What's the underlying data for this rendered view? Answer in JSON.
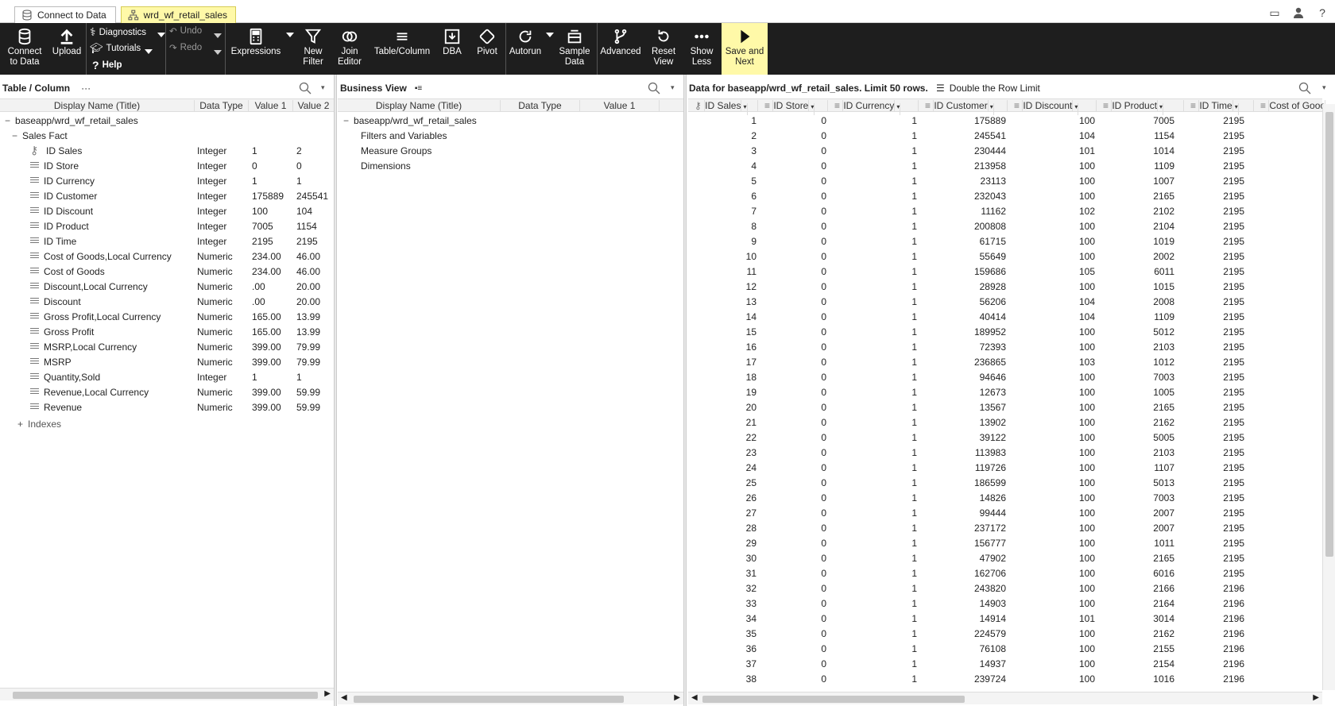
{
  "tabs": [
    {
      "label": "Connect to Data",
      "icon": "database-icon",
      "active": false
    },
    {
      "label": "wrd_wf_retail_sales",
      "icon": "schema-icon",
      "active": true
    }
  ],
  "toolbar": {
    "connect": "Connect\nto Data",
    "upload": "Upload",
    "diagnostics": "Diagnostics",
    "tutorials": "Tutorials",
    "help": "Help",
    "undo": "Undo",
    "redo": "Redo",
    "expressions": "Expressions",
    "new_filter": "New\nFilter",
    "join_editor": "Join\nEditor",
    "table_column": "Table/Column",
    "dba": "DBA",
    "pivot": "Pivot",
    "autorun": "Autorun",
    "sample_data": "Sample\nData",
    "advanced": "Advanced",
    "reset_view": "Reset\nView",
    "show_less": "Show\nLess",
    "save_next": "Save and\nNext"
  },
  "left_panel": {
    "title": "Table / Column",
    "more": "···",
    "columns": [
      "Display Name (Title)",
      "Data Type",
      "Value 1",
      "Value 2"
    ],
    "root": "baseapp/wrd_wf_retail_sales",
    "group": "Sales Fact",
    "rows": [
      {
        "name": "ID Sales",
        "type": "Integer",
        "v1": "1",
        "v2": "2",
        "key": true
      },
      {
        "name": "ID Store",
        "type": "Integer",
        "v1": "0",
        "v2": "0"
      },
      {
        "name": "ID Currency",
        "type": "Integer",
        "v1": "1",
        "v2": "1"
      },
      {
        "name": "ID Customer",
        "type": "Integer",
        "v1": "175889",
        "v2": "245541"
      },
      {
        "name": "ID Discount",
        "type": "Integer",
        "v1": "100",
        "v2": "104"
      },
      {
        "name": "ID Product",
        "type": "Integer",
        "v1": "7005",
        "v2": "1154"
      },
      {
        "name": "ID Time",
        "type": "Integer",
        "v1": "2195",
        "v2": "2195"
      },
      {
        "name": "Cost of Goods,Local Currency",
        "type": "Numeric",
        "v1": "234.00",
        "v2": "46.00"
      },
      {
        "name": "Cost of Goods",
        "type": "Numeric",
        "v1": "234.00",
        "v2": "46.00"
      },
      {
        "name": "Discount,Local Currency",
        "type": "Numeric",
        "v1": ".00",
        "v2": "20.00"
      },
      {
        "name": "Discount",
        "type": "Numeric",
        "v1": ".00",
        "v2": "20.00"
      },
      {
        "name": "Gross Profit,Local Currency",
        "type": "Numeric",
        "v1": "165.00",
        "v2": "13.99"
      },
      {
        "name": "Gross Profit",
        "type": "Numeric",
        "v1": "165.00",
        "v2": "13.99"
      },
      {
        "name": "MSRP,Local Currency",
        "type": "Numeric",
        "v1": "399.00",
        "v2": "79.99"
      },
      {
        "name": "MSRP",
        "type": "Numeric",
        "v1": "399.00",
        "v2": "79.99"
      },
      {
        "name": "Quantity,Sold",
        "type": "Integer",
        "v1": "1",
        "v2": "1"
      },
      {
        "name": "Revenue,Local Currency",
        "type": "Numeric",
        "v1": "399.00",
        "v2": "59.99"
      },
      {
        "name": "Revenue",
        "type": "Numeric",
        "v1": "399.00",
        "v2": "59.99"
      }
    ],
    "indexes": "Indexes"
  },
  "middle_panel": {
    "title": "Business View",
    "columns": [
      "Display Name (Title)",
      "Data Type",
      "Value 1"
    ],
    "root": "baseapp/wrd_wf_retail_sales",
    "items": [
      "Filters and Variables",
      "Measure Groups",
      "Dimensions"
    ]
  },
  "right_panel": {
    "title": "Data for baseapp/wrd_wf_retail_sales. Limit 50 rows.",
    "double_limit": "Double the Row Limit",
    "columns": [
      "ID Sales",
      "ID Store",
      "ID Currency",
      "ID Customer",
      "ID Discount",
      "ID Product",
      "ID Time",
      "Cost of Gooc"
    ],
    "rows": [
      [
        "1",
        "0",
        "1",
        "175889",
        "100",
        "7005",
        "2195"
      ],
      [
        "2",
        "0",
        "1",
        "245541",
        "104",
        "1154",
        "2195"
      ],
      [
        "3",
        "0",
        "1",
        "230444",
        "101",
        "1014",
        "2195"
      ],
      [
        "4",
        "0",
        "1",
        "213958",
        "100",
        "1109",
        "2195"
      ],
      [
        "5",
        "0",
        "1",
        "23113",
        "100",
        "1007",
        "2195"
      ],
      [
        "6",
        "0",
        "1",
        "232043",
        "100",
        "2165",
        "2195"
      ],
      [
        "7",
        "0",
        "1",
        "11162",
        "102",
        "2102",
        "2195"
      ],
      [
        "8",
        "0",
        "1",
        "200808",
        "100",
        "2104",
        "2195"
      ],
      [
        "9",
        "0",
        "1",
        "61715",
        "100",
        "1019",
        "2195"
      ],
      [
        "10",
        "0",
        "1",
        "55649",
        "100",
        "2002",
        "2195"
      ],
      [
        "11",
        "0",
        "1",
        "159686",
        "105",
        "6011",
        "2195"
      ],
      [
        "12",
        "0",
        "1",
        "28928",
        "100",
        "1015",
        "2195"
      ],
      [
        "13",
        "0",
        "1",
        "56206",
        "104",
        "2008",
        "2195"
      ],
      [
        "14",
        "0",
        "1",
        "40414",
        "104",
        "1109",
        "2195"
      ],
      [
        "15",
        "0",
        "1",
        "189952",
        "100",
        "5012",
        "2195"
      ],
      [
        "16",
        "0",
        "1",
        "72393",
        "100",
        "2103",
        "2195"
      ],
      [
        "17",
        "0",
        "1",
        "236865",
        "103",
        "1012",
        "2195"
      ],
      [
        "18",
        "0",
        "1",
        "94646",
        "100",
        "7003",
        "2195"
      ],
      [
        "19",
        "0",
        "1",
        "12673",
        "100",
        "1005",
        "2195"
      ],
      [
        "20",
        "0",
        "1",
        "13567",
        "100",
        "2165",
        "2195"
      ],
      [
        "21",
        "0",
        "1",
        "13902",
        "100",
        "2162",
        "2195"
      ],
      [
        "22",
        "0",
        "1",
        "39122",
        "100",
        "5005",
        "2195"
      ],
      [
        "23",
        "0",
        "1",
        "113983",
        "100",
        "2103",
        "2195"
      ],
      [
        "24",
        "0",
        "1",
        "119726",
        "100",
        "1107",
        "2195"
      ],
      [
        "25",
        "0",
        "1",
        "186599",
        "100",
        "5013",
        "2195"
      ],
      [
        "26",
        "0",
        "1",
        "14826",
        "100",
        "7003",
        "2195"
      ],
      [
        "27",
        "0",
        "1",
        "99444",
        "100",
        "2007",
        "2195"
      ],
      [
        "28",
        "0",
        "1",
        "237172",
        "100",
        "2007",
        "2195"
      ],
      [
        "29",
        "0",
        "1",
        "156777",
        "100",
        "1011",
        "2195"
      ],
      [
        "30",
        "0",
        "1",
        "47902",
        "100",
        "2165",
        "2195"
      ],
      [
        "31",
        "0",
        "1",
        "162706",
        "100",
        "6016",
        "2195"
      ],
      [
        "32",
        "0",
        "1",
        "243820",
        "100",
        "2166",
        "2196"
      ],
      [
        "33",
        "0",
        "1",
        "14903",
        "100",
        "2164",
        "2196"
      ],
      [
        "34",
        "0",
        "1",
        "14914",
        "101",
        "3014",
        "2196"
      ],
      [
        "35",
        "0",
        "1",
        "224579",
        "100",
        "2162",
        "2196"
      ],
      [
        "36",
        "0",
        "1",
        "76108",
        "100",
        "2155",
        "2196"
      ],
      [
        "37",
        "0",
        "1",
        "14937",
        "100",
        "2154",
        "2196"
      ],
      [
        "38",
        "0",
        "1",
        "239724",
        "100",
        "1016",
        "2196"
      ]
    ]
  }
}
